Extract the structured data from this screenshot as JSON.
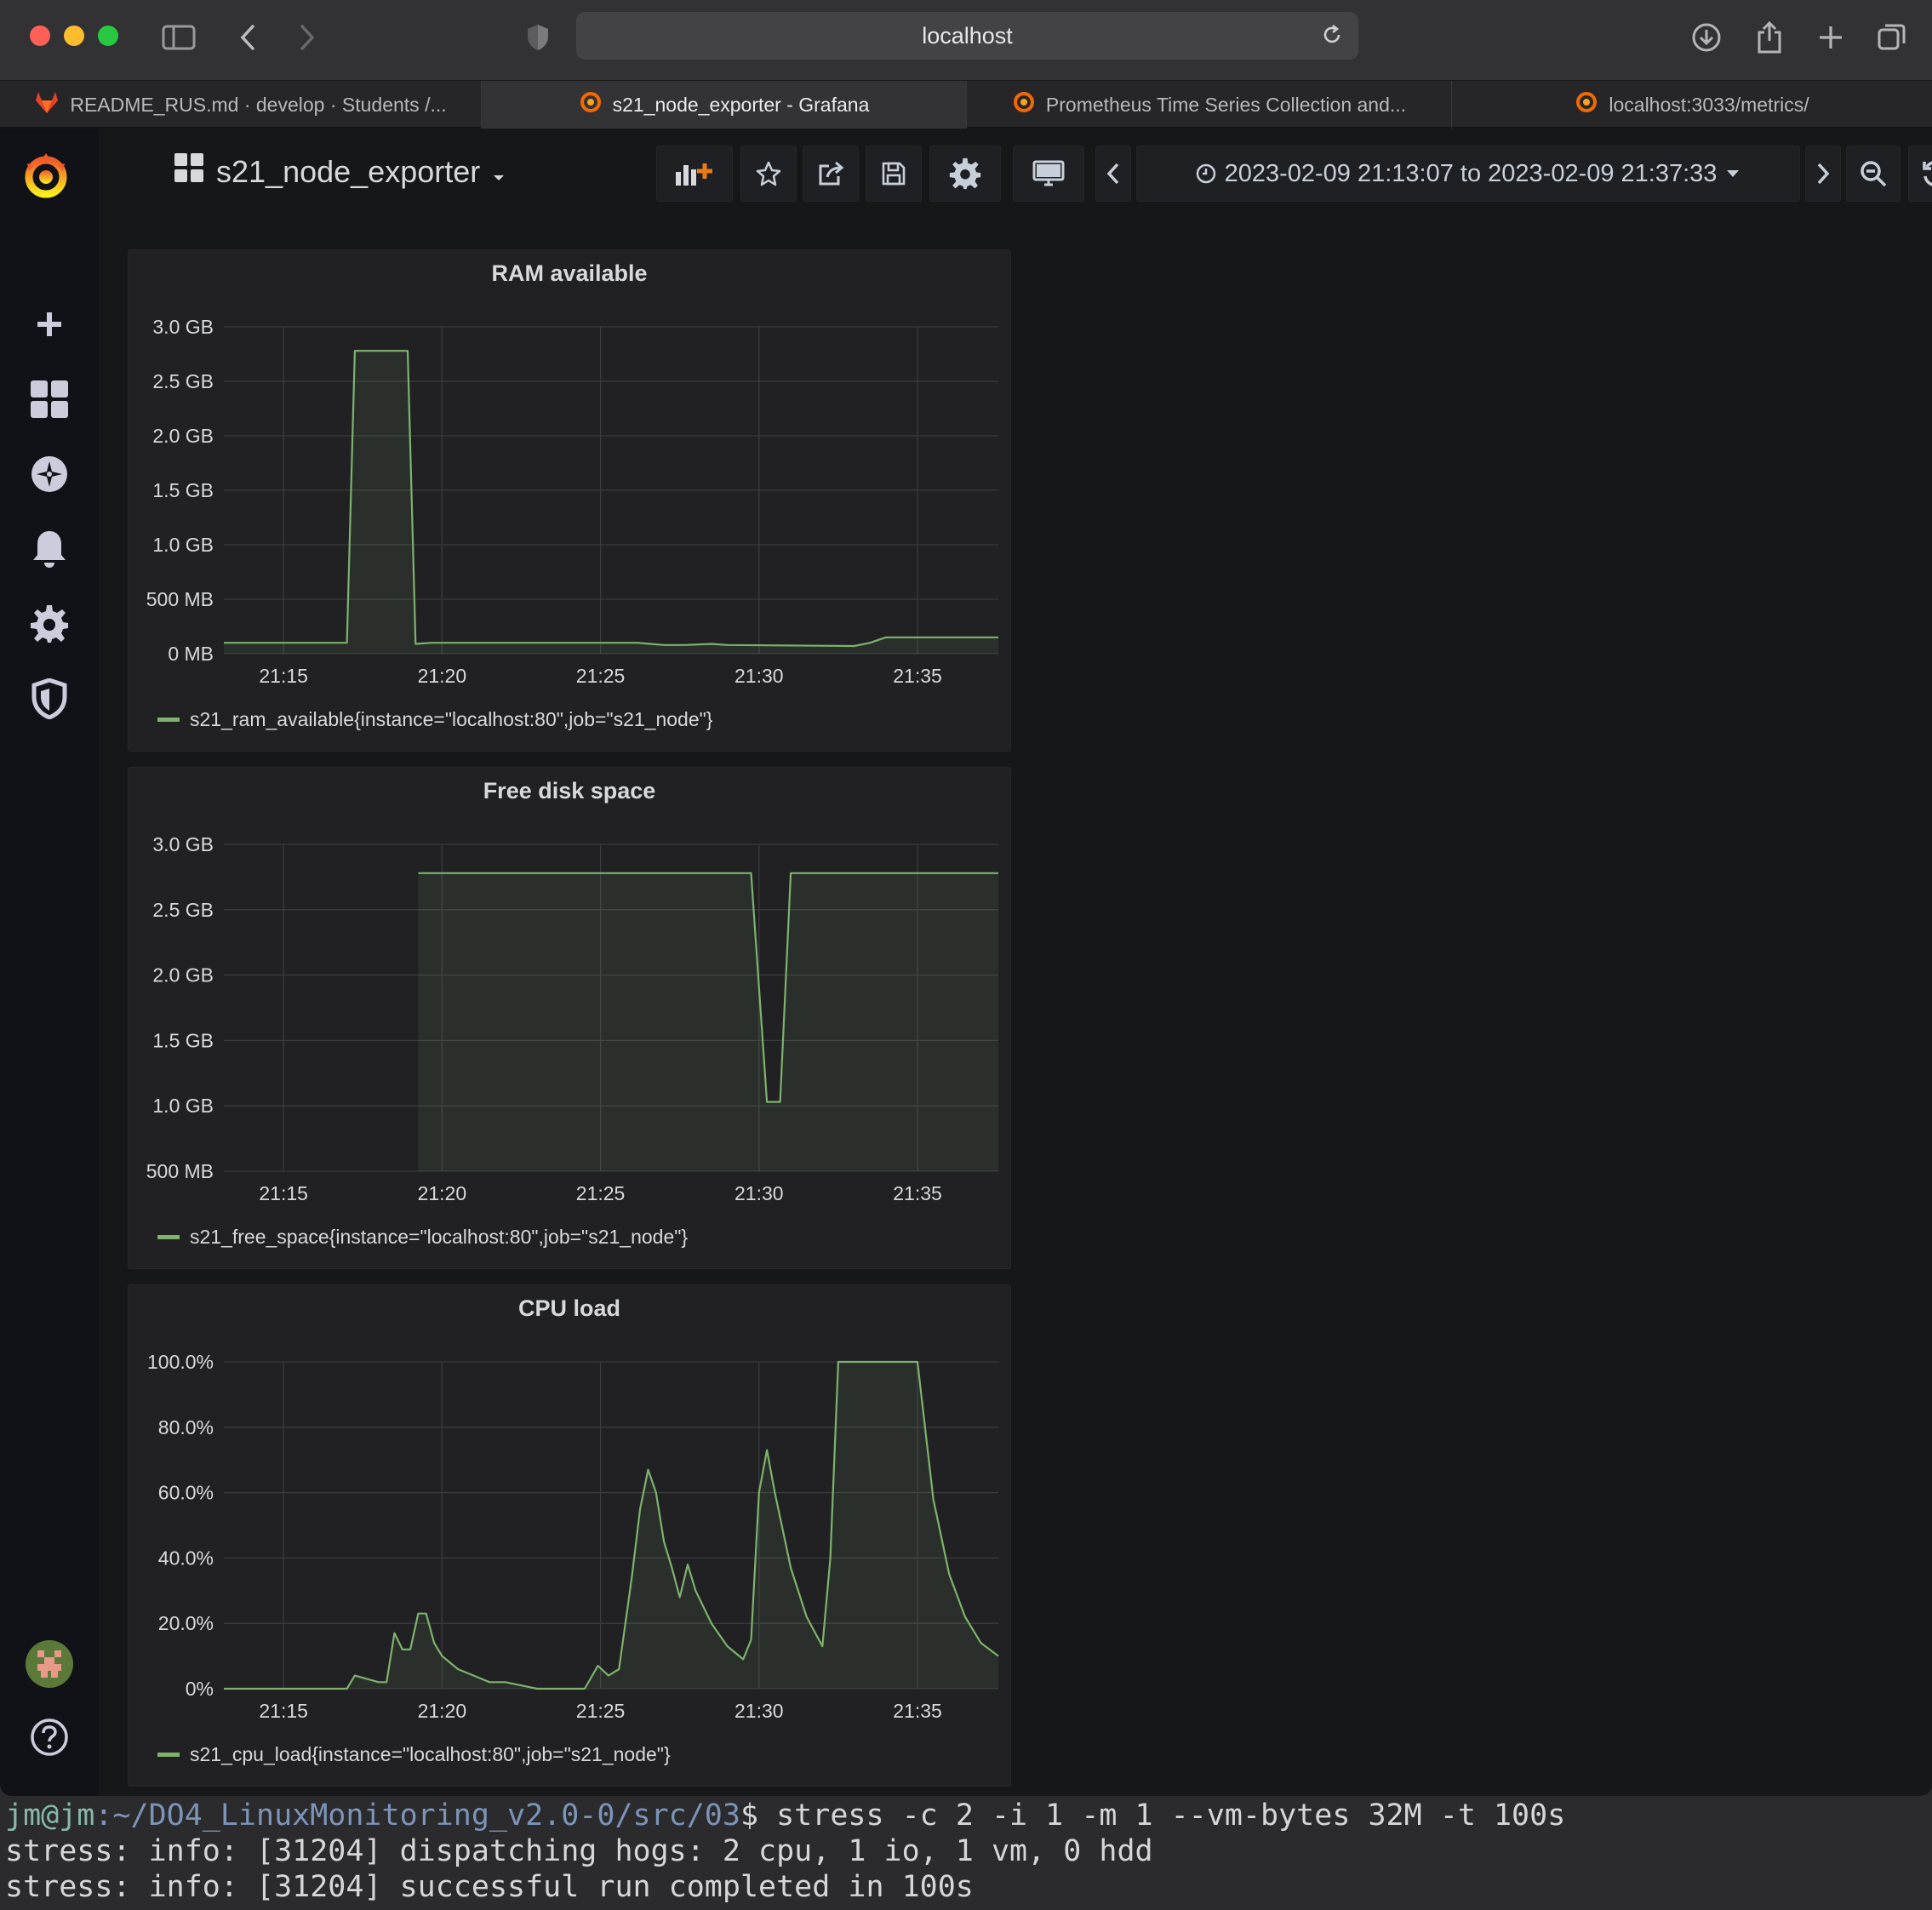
{
  "browser": {
    "url": "localhost",
    "tabs": [
      {
        "label": "README_RUS.md · develop · Students /...",
        "icon": "gitlab-icon"
      },
      {
        "label": "s21_node_exporter - Grafana",
        "icon": "grafana-icon"
      },
      {
        "label": "Prometheus Time Series Collection and...",
        "icon": "grafana-icon"
      },
      {
        "label": "localhost:3033/metrics/",
        "icon": "grafana-icon"
      }
    ]
  },
  "dashboard": {
    "title": "s21_node_exporter",
    "time_range": "2023-02-09 21:13:07 to 2023-02-09 21:37:33"
  },
  "colors": {
    "series": "#7eb26d",
    "grafana_orange": "#f46800"
  },
  "chart_data": [
    {
      "type": "area",
      "title": "RAM available",
      "x_ticks": [
        "21:15",
        "21:20",
        "21:25",
        "21:30",
        "21:35"
      ],
      "y_ticks": [
        "0 MB",
        "500 MB",
        "1.0 GB",
        "1.5 GB",
        "2.0 GB",
        "2.5 GB",
        "3.0 GB"
      ],
      "ylim": [
        0,
        3.0
      ],
      "xlim": [
        "21:13:07",
        "21:37:33"
      ],
      "series": [
        {
          "name": "s21_ram_available{instance=\"localhost:80\",job=\"s21_node\"}",
          "x": [
            "21:13:07",
            "21:17:00",
            "21:17:15",
            "21:18:55",
            "21:19:10",
            "21:19:40",
            "21:20:30",
            "21:26:10",
            "21:27:00",
            "21:27:40",
            "21:28:30",
            "21:29:00",
            "21:33:00",
            "21:33:30",
            "21:34:00",
            "21:37:33"
          ],
          "y": [
            0.1,
            0.1,
            2.78,
            2.78,
            0.09,
            0.1,
            0.1,
            0.1,
            0.08,
            0.08,
            0.09,
            0.08,
            0.07,
            0.1,
            0.15,
            0.15
          ]
        }
      ]
    },
    {
      "type": "area",
      "title": "Free disk space",
      "x_ticks": [
        "21:15",
        "21:20",
        "21:25",
        "21:30",
        "21:35"
      ],
      "y_ticks": [
        "500 MB",
        "1.0 GB",
        "1.5 GB",
        "2.0 GB",
        "2.5 GB",
        "3.0 GB"
      ],
      "ylim": [
        0.5,
        3.0
      ],
      "xlim": [
        "21:13:07",
        "21:37:33"
      ],
      "series": [
        {
          "name": "s21_free_space{instance=\"localhost:80\",job=\"s21_node\"}",
          "x": [
            "21:19:15",
            "21:29:45",
            "21:30:15",
            "21:30:40",
            "21:31:00",
            "21:37:33"
          ],
          "y": [
            2.78,
            2.78,
            1.03,
            1.03,
            2.78,
            2.78
          ]
        }
      ]
    },
    {
      "type": "area",
      "title": "CPU load",
      "x_ticks": [
        "21:15",
        "21:20",
        "21:25",
        "21:30",
        "21:35"
      ],
      "y_ticks": [
        "0%",
        "20.0%",
        "40.0%",
        "60.0%",
        "80.0%",
        "100.0%"
      ],
      "ylim": [
        0,
        100
      ],
      "xlim": [
        "21:13:07",
        "21:37:33"
      ],
      "series": [
        {
          "name": "s21_cpu_load{instance=\"localhost:80\",job=\"s21_node\"}",
          "x": [
            "21:13:07",
            "21:17:00",
            "21:17:15",
            "21:18:00",
            "21:18:15",
            "21:18:30",
            "21:18:45",
            "21:19:00",
            "21:19:15",
            "21:19:30",
            "21:19:45",
            "21:20:00",
            "21:20:30",
            "21:21:00",
            "21:21:30",
            "21:22:00",
            "21:22:30",
            "21:23:00",
            "21:24:30",
            "21:24:55",
            "21:25:15",
            "21:25:35",
            "21:26:00",
            "21:26:15",
            "21:26:30",
            "21:26:45",
            "21:27:00",
            "21:27:15",
            "21:27:30",
            "21:27:45",
            "21:28:00",
            "21:28:30",
            "21:29:00",
            "21:29:30",
            "21:29:45",
            "21:30:00",
            "21:30:15",
            "21:30:30",
            "21:31:00",
            "21:31:30",
            "21:32:00",
            "21:32:15",
            "21:32:30",
            "21:33:00",
            "21:34:00",
            "21:34:15",
            "21:34:30",
            "21:35:00",
            "21:35:30",
            "21:36:00",
            "21:36:30",
            "21:37:00",
            "21:37:33"
          ],
          "y": [
            0,
            0,
            4,
            2,
            2,
            17,
            12,
            12,
            23,
            23,
            14,
            10,
            6,
            4,
            2,
            2,
            1,
            0,
            0,
            7,
            4,
            6,
            35,
            55,
            67,
            60,
            45,
            37,
            28,
            38,
            30,
            20,
            13,
            9,
            15,
            60,
            73,
            60,
            37,
            22,
            13,
            40,
            100,
            100,
            100,
            100,
            100,
            100,
            58,
            35,
            22,
            14,
            10
          ]
        }
      ]
    }
  ],
  "terminal": {
    "prompt_user": "jm@jm",
    "prompt_path": ":~/DO4_LinuxMonitoring_v2.0-0/src/03",
    "prompt_symbol": "$",
    "command": " stress -c 2 -i 1 -m 1 --vm-bytes 32M -t 100s",
    "output": [
      "stress: info: [31204] dispatching hogs: 2 cpu, 1 io, 1 vm, 0 hdd",
      "stress: info: [31204] successful run completed in 100s"
    ]
  }
}
